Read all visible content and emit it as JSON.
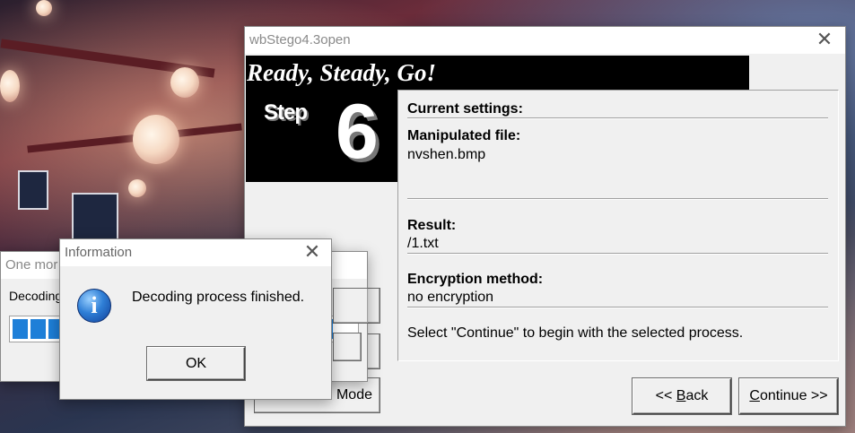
{
  "main_window": {
    "title": "wbStego4.3open",
    "banner": "Ready, Steady, Go!",
    "step_word": "Step",
    "step_number": "6",
    "settings": {
      "heading": "Current settings:",
      "manipulated_label": "Manipulated file:",
      "manipulated_value": "nvshen.bmp",
      "result_label": "Result:",
      "result_value": "/1.txt",
      "encryption_label": "Encryption method:",
      "encryption_value": "no encryption",
      "hint": "Select \"Continue\" to begin with the selected process."
    },
    "back_prefix": "<< ",
    "back_hotkey": "B",
    "back_rest": "ack",
    "continue_hotkey": "C",
    "continue_rest": "ontinue >>",
    "flowchart_button_visible_text": "Mode"
  },
  "progress_window": {
    "title": "One mor",
    "label": "Decoding",
    "progress": 1.0
  },
  "info_dialog": {
    "title": "Information",
    "message": "Decoding process finished.",
    "ok_label": "OK",
    "icon": "info-icon"
  },
  "icons": {
    "close": "close-icon"
  }
}
